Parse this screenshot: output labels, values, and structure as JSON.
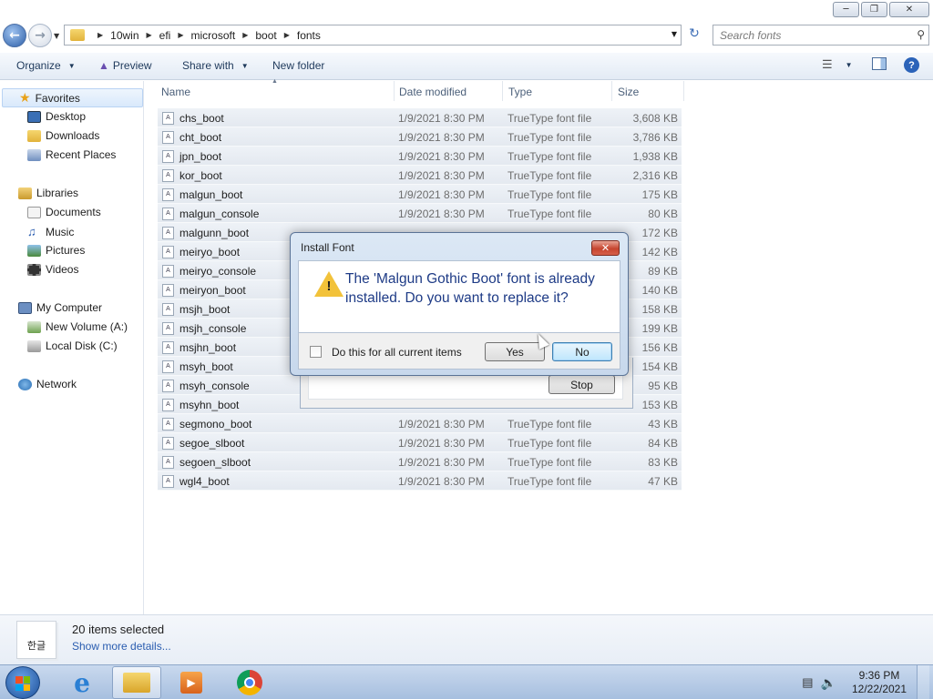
{
  "address": {
    "crumbs": [
      "10win",
      "efi",
      "microsoft",
      "boot",
      "fonts"
    ]
  },
  "search": {
    "placeholder": "Search fonts"
  },
  "toolbar": {
    "organize": "Organize",
    "preview": "Preview",
    "share_with": "Share with",
    "new_folder": "New folder"
  },
  "sidebar": {
    "favorites": "Favorites",
    "desktop": "Desktop",
    "downloads": "Downloads",
    "recent_places": "Recent Places",
    "libraries": "Libraries",
    "documents": "Documents",
    "music": "Music",
    "pictures": "Pictures",
    "videos": "Videos",
    "my_computer": "My Computer",
    "new_volume": "New Volume (A:)",
    "local_disk": "Local Disk (C:)",
    "network": "Network"
  },
  "columns": {
    "name": "Name",
    "date": "Date modified",
    "type": "Type",
    "size": "Size"
  },
  "files": [
    {
      "name": "chs_boot",
      "date": "1/9/2021 8:30 PM",
      "type": "TrueType font file",
      "size": "3,608 KB"
    },
    {
      "name": "cht_boot",
      "date": "1/9/2021 8:30 PM",
      "type": "TrueType font file",
      "size": "3,786 KB"
    },
    {
      "name": "jpn_boot",
      "date": "1/9/2021 8:30 PM",
      "type": "TrueType font file",
      "size": "1,938 KB"
    },
    {
      "name": "kor_boot",
      "date": "1/9/2021 8:30 PM",
      "type": "TrueType font file",
      "size": "2,316 KB"
    },
    {
      "name": "malgun_boot",
      "date": "1/9/2021 8:30 PM",
      "type": "TrueType font file",
      "size": "175 KB"
    },
    {
      "name": "malgun_console",
      "date": "1/9/2021 8:30 PM",
      "type": "TrueType font file",
      "size": "80 KB"
    },
    {
      "name": "malgunn_boot",
      "date": "",
      "type": "",
      "size": "172 KB"
    },
    {
      "name": "meiryo_boot",
      "date": "",
      "type": "",
      "size": "142 KB"
    },
    {
      "name": "meiryo_console",
      "date": "",
      "type": "",
      "size": "89 KB"
    },
    {
      "name": "meiryon_boot",
      "date": "",
      "type": "",
      "size": "140 KB"
    },
    {
      "name": "msjh_boot",
      "date": "",
      "type": "",
      "size": "158 KB"
    },
    {
      "name": "msjh_console",
      "date": "",
      "type": "",
      "size": "199 KB"
    },
    {
      "name": "msjhn_boot",
      "date": "",
      "type": "",
      "size": "156 KB"
    },
    {
      "name": "msyh_boot",
      "date": "",
      "type": "",
      "size": "154 KB"
    },
    {
      "name": "msyh_console",
      "date": "",
      "type": "",
      "size": "95 KB"
    },
    {
      "name": "msyhn_boot",
      "date": "",
      "type": "",
      "size": "153 KB"
    },
    {
      "name": "segmono_boot",
      "date": "1/9/2021 8:30 PM",
      "type": "TrueType font file",
      "size": "43 KB"
    },
    {
      "name": "segoe_slboot",
      "date": "1/9/2021 8:30 PM",
      "type": "TrueType font file",
      "size": "84 KB"
    },
    {
      "name": "segoen_slboot",
      "date": "1/9/2021 8:30 PM",
      "type": "TrueType font file",
      "size": "83 KB"
    },
    {
      "name": "wgl4_boot",
      "date": "1/9/2021 8:30 PM",
      "type": "TrueType font file",
      "size": "47 KB"
    }
  ],
  "details": {
    "icon_text": "한글",
    "selected": "20 items selected",
    "more": "Show more details..."
  },
  "dialog": {
    "title": "Install Font",
    "message": "The 'Malgun Gothic Boot' font is already installed. Do you want to replace it?",
    "checkbox_label": "Do this for all current items",
    "yes": "Yes",
    "no": "No",
    "close": "✕"
  },
  "progress_dialog": {
    "stop": "Stop"
  },
  "clock": {
    "time": "9:36 PM",
    "date": "12/22/2021"
  },
  "icons": [
    "back-icon",
    "forward-icon",
    "folder-icon",
    "refresh-icon",
    "search-icon",
    "star-icon",
    "help-icon",
    "warning-icon",
    "chrome-icon",
    "ie-icon"
  ]
}
